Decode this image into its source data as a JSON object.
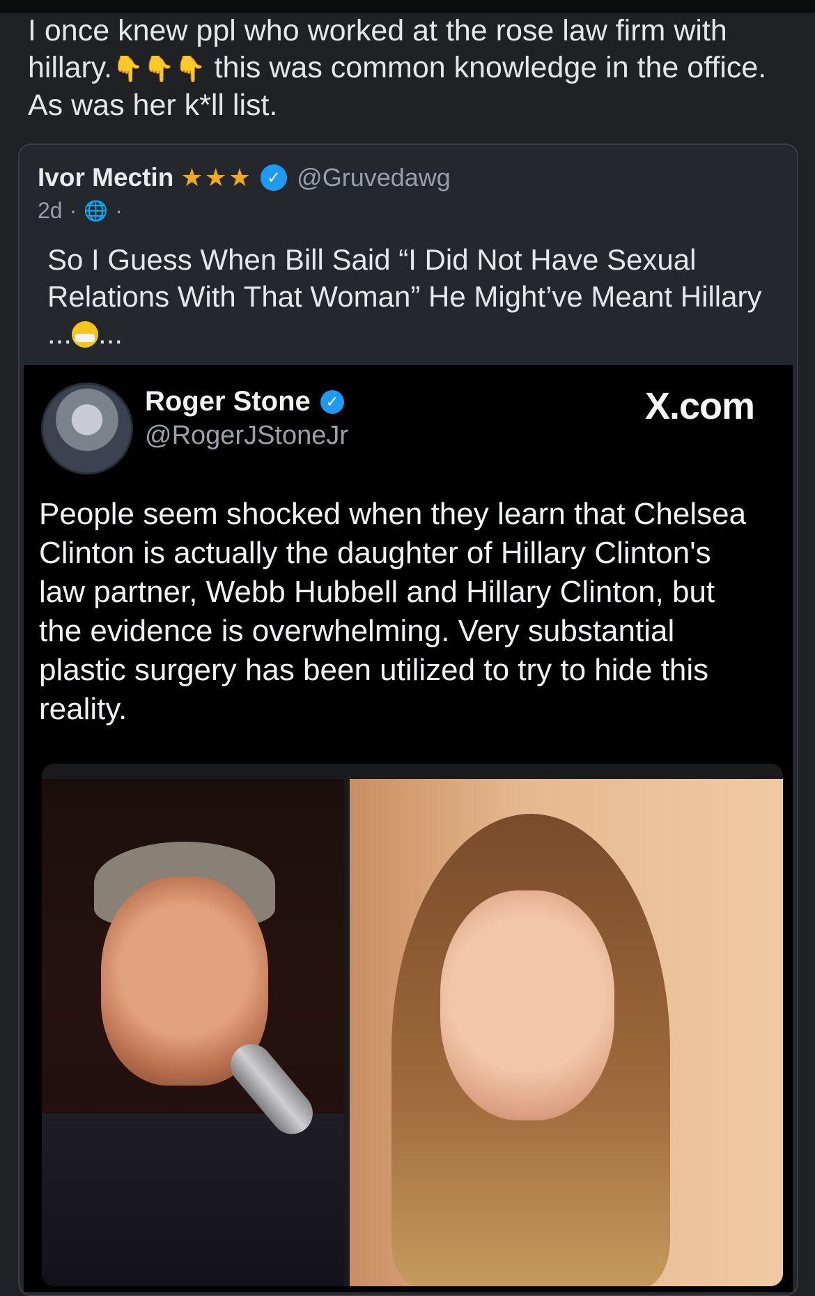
{
  "post": {
    "text_line1": "I once knew ppl who worked at the rose law firm with",
    "text_line2_a": "hillary.",
    "text_line2_emoji": "👇👇👇",
    "text_line2_b": " this was common knowledge in the office.",
    "text_line3": "As was her k*ll list."
  },
  "quoted": {
    "author_name": "Ivor Mectin",
    "stars": "★★★",
    "verified_mark": "✓",
    "handle": "@Gruvedawg",
    "time": "2d",
    "dot": "·",
    "text_a": "So I Guess When Bill Said “I Did Not Have Sexual Relations With That Woman” He Might’ve Meant Hillary ...",
    "text_b": "..."
  },
  "tweet_image": {
    "author_name": "Roger Stone",
    "verified_mark": "✓",
    "handle": "@RogerJStoneJr",
    "brand": "X.com",
    "body": "People seem shocked when they learn that Chelsea Clinton is actually the daughter of Hillary Clinton's law partner, Webb Hubbell and Hillary Clinton, but the evidence is overwhelming. Very substantial plastic surgery has been utilized to try to hide this reality."
  },
  "colors": {
    "background": "#1f2124",
    "verified": "#1d9bf0",
    "stars": "#f0a81c"
  }
}
